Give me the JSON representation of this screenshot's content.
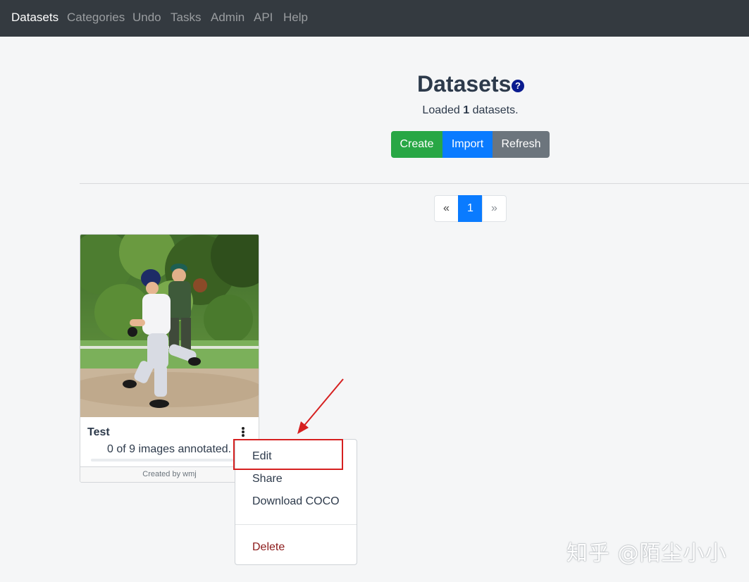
{
  "nav": {
    "items": [
      {
        "label": "Datasets",
        "active": true
      },
      {
        "label": "Categories"
      },
      {
        "label": "Undo"
      },
      {
        "label": "Tasks"
      },
      {
        "label": "Admin"
      },
      {
        "label": "API"
      },
      {
        "label": "Help"
      }
    ]
  },
  "header": {
    "title": "Datasets",
    "help_icon": "question-circle-icon",
    "loaded_prefix": "Loaded",
    "loaded_count": "1",
    "loaded_suffix": "datasets."
  },
  "actions": {
    "create": "Create",
    "import": "Import",
    "refresh": "Refresh"
  },
  "colors": {
    "create": "#28a745",
    "import": "#0a7bff",
    "refresh": "#6c757d",
    "navbar": "#343a40",
    "delete_text": "#8b1a1a",
    "highlight": "#d62020"
  },
  "pagination": {
    "prev": "«",
    "current": "1",
    "next": "»"
  },
  "dataset_card": {
    "name": "Test",
    "status": "0 of 9 images annotated.",
    "annotated": 0,
    "total_images": 9,
    "progress_fraction": 0,
    "footer": "Created by wmj",
    "menu_icon": "kebab-vertical-icon"
  },
  "dropdown": {
    "edit": "Edit",
    "share": "Share",
    "download": "Download COCO",
    "delete": "Delete"
  },
  "watermark": "知乎 @陌尘小小"
}
